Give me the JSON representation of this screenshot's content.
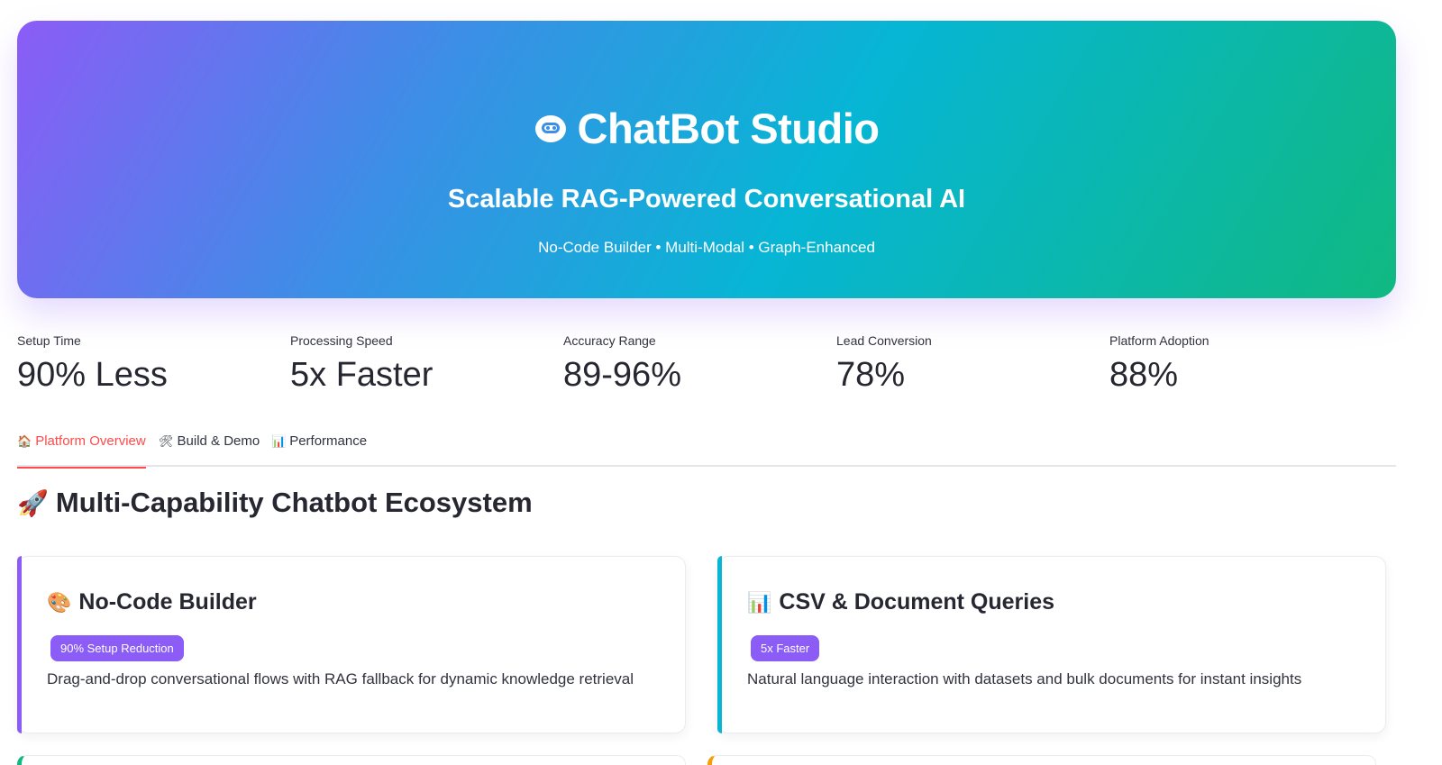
{
  "hero": {
    "title": "ChatBot Studio",
    "title_icon": "robot-face-icon",
    "subtitle": "Scalable RAG-Powered Conversational AI",
    "tagline": "No-Code Builder • Multi-Modal • Graph-Enhanced",
    "gradient_colors": [
      "#8b5cf6",
      "#06b6d4",
      "#10b981"
    ]
  },
  "metrics": [
    {
      "label": "Setup Time",
      "value": "90% Less"
    },
    {
      "label": "Processing Speed",
      "value": "5x Faster"
    },
    {
      "label": "Accuracy Range",
      "value": "89-96%"
    },
    {
      "label": "Lead Conversion",
      "value": "78%"
    },
    {
      "label": "Platform Adoption",
      "value": "88%"
    }
  ],
  "tabs": [
    {
      "icon": "🏠",
      "label": "Platform Overview",
      "active": true
    },
    {
      "icon": "🛠",
      "label": "Build & Demo",
      "active": false
    },
    {
      "icon": "📊",
      "label": "Performance",
      "active": false
    }
  ],
  "section": {
    "icon": "🚀",
    "title": "Multi-Capability Chatbot Ecosystem"
  },
  "cards": [
    {
      "icon": "🎨",
      "title": "No-Code Builder",
      "badge": "90% Setup Reduction",
      "description": "Drag-and-drop conversational flows with RAG fallback for dynamic knowledge retrieval",
      "accent": "#8b5cf6"
    },
    {
      "icon": "📊",
      "title": "CSV & Document Queries",
      "badge": "5x Faster",
      "description": "Natural language interaction with datasets and bulk documents for instant insights",
      "accent": "#06b6d4"
    }
  ],
  "colors": {
    "active_tab": "#ff4b4b",
    "badge": "#8b5cf6",
    "text": "#262730"
  }
}
